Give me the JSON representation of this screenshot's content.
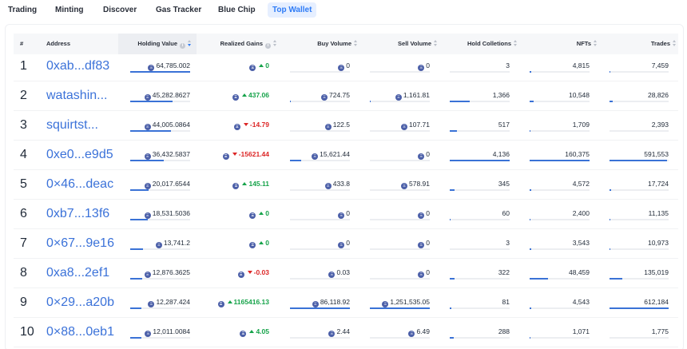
{
  "tabs": [
    {
      "label": "Trading",
      "active": false
    },
    {
      "label": "Minting",
      "active": false
    },
    {
      "label": "Discover",
      "active": false
    },
    {
      "label": "Gas Tracker",
      "active": false
    },
    {
      "label": "Blue Chip",
      "active": false
    },
    {
      "label": "Top Wallet",
      "active": true
    }
  ],
  "colors": {
    "accent": "#2f7cf6",
    "link": "#3b72d9",
    "positive": "#16a34a",
    "negative": "#dc2626",
    "bar": "#3a72d6"
  },
  "icons": {
    "currency": "eth-icon",
    "info": "info-icon",
    "sort": "sort-icon",
    "up": "triangle-up-icon",
    "down": "triangle-down-icon"
  },
  "table": {
    "headers": {
      "rank": "#",
      "address": "Address",
      "holding": "Holding Value",
      "gains": "Realized Gains",
      "buy": "Buy Volume",
      "sell": "Sell Volume",
      "hold": "Hold Colletions",
      "nfts": "NFTs",
      "trades": "Trades"
    },
    "rows": [
      {
        "rank": "1",
        "address": "0xab...df83",
        "holding": "64,785.002",
        "holding_fill": 1.0,
        "gain": "0",
        "dir": "up",
        "buy": "0",
        "buy_fill": 0,
        "sell": "0",
        "sell_fill": 0,
        "hold": "3",
        "hold_fill": 0,
        "nfts": "4,815",
        "nfts_fill": 0.02,
        "trades": "7,459",
        "trades_fill": 0.01
      },
      {
        "rank": "2",
        "address": "watashin...",
        "holding": "45,282.8627",
        "holding_fill": 0.7,
        "gain": "437.06",
        "dir": "up",
        "buy": "724.75",
        "buy_fill": 0.01,
        "sell": "1,161.81",
        "sell_fill": 0.01,
        "hold": "1,366",
        "hold_fill": 0.33,
        "nfts": "10,548",
        "nfts_fill": 0.07,
        "trades": "28,826",
        "trades_fill": 0.05
      },
      {
        "rank": "3",
        "address": "squirtst...",
        "holding": "44,005.0864",
        "holding_fill": 0.68,
        "gain": "-14.79",
        "dir": "down",
        "buy": "122.5",
        "buy_fill": 0.0,
        "sell": "107.71",
        "sell_fill": 0.0,
        "hold": "517",
        "hold_fill": 0.12,
        "nfts": "1,709",
        "nfts_fill": 0.01,
        "trades": "2,393",
        "trades_fill": 0.0
      },
      {
        "rank": "4",
        "address": "0xe0...e9d5",
        "holding": "36,432.5837",
        "holding_fill": 0.56,
        "gain": "-15621.44",
        "dir": "down",
        "buy": "15,621.44",
        "buy_fill": 0.18,
        "sell": "0",
        "sell_fill": 0,
        "hold": "4,136",
        "hold_fill": 1.0,
        "nfts": "160,375",
        "nfts_fill": 1.0,
        "trades": "591,553",
        "trades_fill": 0.97
      },
      {
        "rank": "5",
        "address": "0×46...deac",
        "holding": "20,017.6544",
        "holding_fill": 0.31,
        "gain": "145.11",
        "dir": "up",
        "buy": "433.8",
        "buy_fill": 0.0,
        "sell": "578.91",
        "sell_fill": 0.0,
        "hold": "345",
        "hold_fill": 0.08,
        "nfts": "4,572",
        "nfts_fill": 0.03,
        "trades": "17,724",
        "trades_fill": 0.03
      },
      {
        "rank": "6",
        "address": "0xb7...13f6",
        "holding": "18,531.5036",
        "holding_fill": 0.29,
        "gain": "0",
        "dir": "up",
        "buy": "0",
        "buy_fill": 0,
        "sell": "0",
        "sell_fill": 0,
        "hold": "60",
        "hold_fill": 0.01,
        "nfts": "2,400",
        "nfts_fill": 0.01,
        "trades": "11,135",
        "trades_fill": 0.02
      },
      {
        "rank": "7",
        "address": "0×67...9e16",
        "holding": "13,741.2",
        "holding_fill": 0.21,
        "gain": "0",
        "dir": "up",
        "buy": "0",
        "buy_fill": 0,
        "sell": "0",
        "sell_fill": 0,
        "hold": "3",
        "hold_fill": 0,
        "nfts": "3,543",
        "nfts_fill": 0.02,
        "trades": "10,973",
        "trades_fill": 0.02
      },
      {
        "rank": "8",
        "address": "0xa8...2ef1",
        "holding": "12,876.3625",
        "holding_fill": 0.2,
        "gain": "-0.03",
        "dir": "down",
        "buy": "0.03",
        "buy_fill": 0,
        "sell": "0",
        "sell_fill": 0,
        "hold": "322",
        "hold_fill": 0.08,
        "nfts": "48,459",
        "nfts_fill": 0.3,
        "trades": "135,019",
        "trades_fill": 0.22
      },
      {
        "rank": "9",
        "address": "0×29...a20b",
        "holding": "12,287.424",
        "holding_fill": 0.19,
        "gain": "1165416.13",
        "dir": "up",
        "buy": "86,118.92",
        "buy_fill": 1.0,
        "sell": "1,251,535.05",
        "sell_fill": 1.0,
        "hold": "81",
        "hold_fill": 0.02,
        "nfts": "4,543",
        "nfts_fill": 0.03,
        "trades": "612,184",
        "trades_fill": 1.0
      },
      {
        "rank": "10",
        "address": "0×88...0eb1",
        "holding": "12,011.0084",
        "holding_fill": 0.19,
        "gain": "4.05",
        "dir": "up",
        "buy": "2.44",
        "buy_fill": 0,
        "sell": "6.49",
        "sell_fill": 0,
        "hold": "288",
        "hold_fill": 0.07,
        "nfts": "1,071",
        "nfts_fill": 0.01,
        "trades": "1,775",
        "trades_fill": 0.0
      }
    ]
  }
}
